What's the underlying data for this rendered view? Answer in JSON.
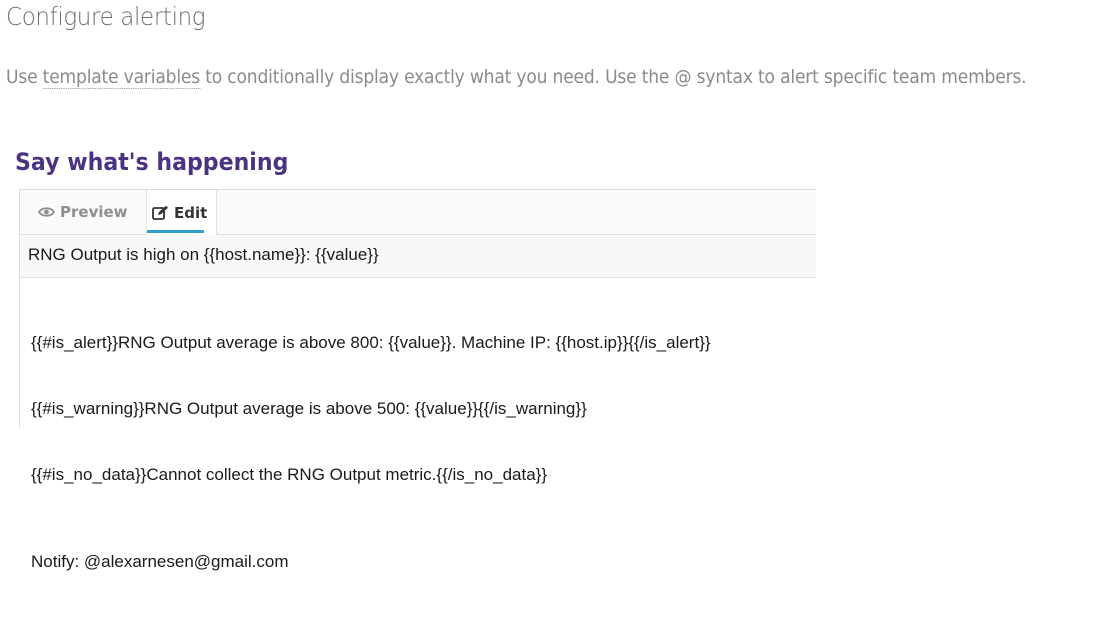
{
  "header": {
    "title": "Configure alerting",
    "intro_before": "Use ",
    "intro_link": "template variables",
    "intro_after": " to conditionally display exactly what you need. Use the @ syntax to alert specific team members."
  },
  "section": {
    "title": "Say what's happening"
  },
  "editor": {
    "tabs": {
      "preview_label": "Preview",
      "edit_label": "Edit",
      "active": "Edit"
    },
    "title_value": "RNG Output is high on {{host.name}}: {{value}}",
    "body_lines": [
      "{{#is_alert}}RNG Output average is above 800: {{value}}. Machine IP: {{host.ip}}{{/is_alert}}",
      "{{#is_warning}}RNG Output average is above 500: {{value}}{{/is_warning}}",
      "{{#is_no_data}}Cannot collect the RNG Output metric.{{/is_no_data}}"
    ],
    "notify_line": "Notify: @alexarnesen@gmail.com"
  },
  "colors": {
    "section_title": "#4b3382",
    "active_tab_underline": "#2f9fc9"
  }
}
